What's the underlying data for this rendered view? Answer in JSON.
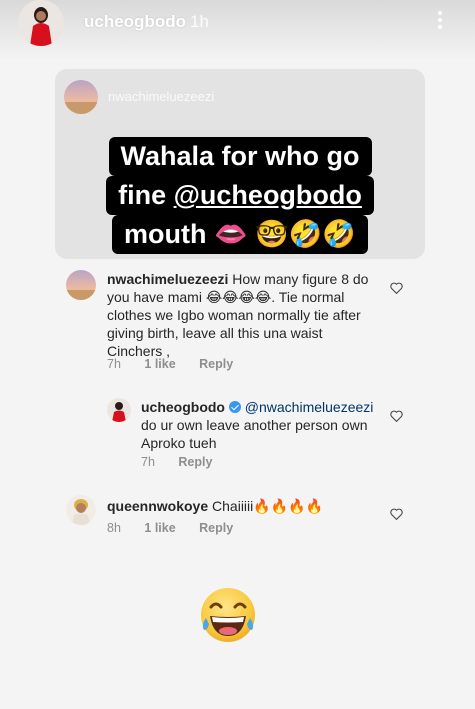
{
  "story": {
    "username": "ucheogbodo",
    "time": "1h"
  },
  "post": {
    "username": "nwachimeluezeezi",
    "caption_line1": "Wahala for who go",
    "caption_line2_prefix": "fine ",
    "caption_mention": "@ucheogbodo",
    "caption_line3": "mouth 👄 🤓🤣🤣"
  },
  "comments": [
    {
      "username": "nwachimeluezeezi",
      "text": "How many figure 8 do you have mami 😂😂😂😂. Tie normal clothes we Igbo woman normally tie after giving birth,  leave all this una waist  Cinchers ,",
      "time": "7h",
      "likes": "1 like",
      "reply": "Reply"
    },
    {
      "username": "ucheogbodo",
      "mention": "@nwachimeluezeezi",
      "text": "do ur own leave another person own Aproko tueh",
      "time": "7h",
      "reply": "Reply"
    },
    {
      "username": "queennwokoye",
      "text": "Chaiiiii🔥🔥🔥🔥",
      "time": "8h",
      "likes": "1 like",
      "reply": "Reply"
    }
  ],
  "colors": {
    "background": "#f4f4f4",
    "card": "#e3e3e3",
    "verified": "#3897f0"
  },
  "icons": [
    "more-vertical-icon",
    "heart-icon",
    "verified-badge-icon",
    "laughing-face-icon"
  ]
}
